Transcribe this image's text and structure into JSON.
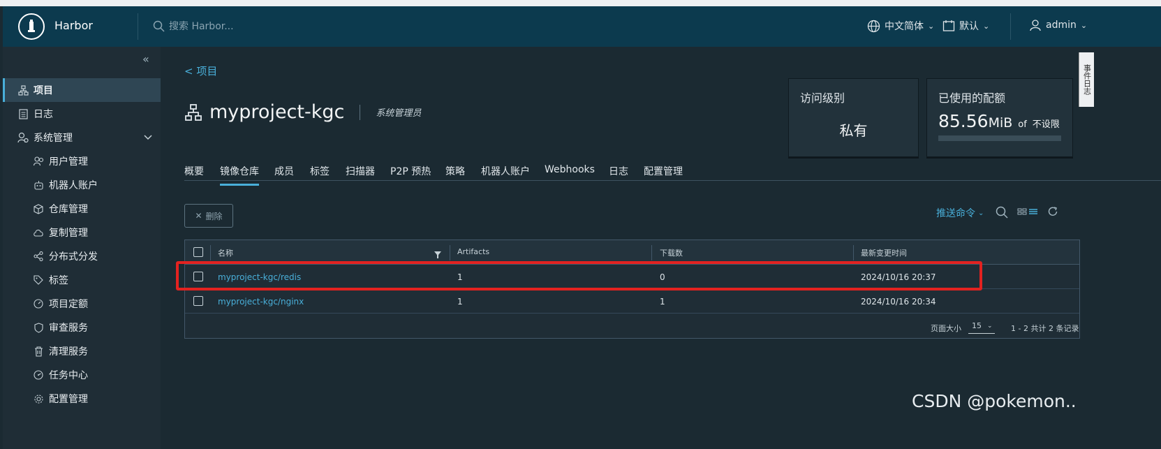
{
  "header": {
    "brand": "Harbor",
    "search_placeholder": "搜索 Harbor...",
    "language": "中文简体",
    "theme": "默认",
    "user": "admin"
  },
  "sidebar": {
    "items": [
      {
        "label": "项目",
        "icon": "project-icon"
      },
      {
        "label": "日志",
        "icon": "log-icon"
      },
      {
        "label": "系统管理",
        "icon": "admin-icon"
      },
      {
        "label": "用户管理",
        "icon": "users-icon"
      },
      {
        "label": "机器人账户",
        "icon": "robot-icon"
      },
      {
        "label": "仓库管理",
        "icon": "cube-icon"
      },
      {
        "label": "复制管理",
        "icon": "cloud-icon"
      },
      {
        "label": "分布式分发",
        "icon": "share-icon"
      },
      {
        "label": "标签",
        "icon": "tag-icon"
      },
      {
        "label": "项目定额",
        "icon": "gauge-icon"
      },
      {
        "label": "审查服务",
        "icon": "shield-icon"
      },
      {
        "label": "清理服务",
        "icon": "trash-icon"
      },
      {
        "label": "任务中心",
        "icon": "dashboard-icon"
      },
      {
        "label": "配置管理",
        "icon": "gear-icon"
      }
    ]
  },
  "main": {
    "back_label": "<  项目",
    "title": "myproject-kgc",
    "role": "系统管理员",
    "access_card": {
      "title": "访问级别",
      "value": "私有"
    },
    "quota_card": {
      "title": "已使用的配额",
      "value": "85.56",
      "unit": "MiB",
      "of": "of",
      "limit": "不设限"
    },
    "tabs": [
      "概要",
      "镜像仓库",
      "成员",
      "标签",
      "扫描器",
      "P2P 预热",
      "策略",
      "机器人账户",
      "Webhooks",
      "日志",
      "配置管理"
    ],
    "active_tab": "镜像仓库",
    "delete_label": "删除",
    "push_command_label": "推送命令",
    "table": {
      "columns": [
        "名称",
        "Artifacts",
        "下载数",
        "最新变更时间"
      ],
      "rows": [
        {
          "name": "myproject-kgc/redis",
          "artifacts": "1",
          "pulls": "0",
          "updated": "2024/10/16 20:37"
        },
        {
          "name": "myproject-kgc/nginx",
          "artifacts": "1",
          "pulls": "1",
          "updated": "2024/10/16 20:34"
        }
      ],
      "page_size_label": "页面大小",
      "page_size": "15",
      "summary": "1 - 2 共计 2 条记录"
    }
  },
  "side_tab": "事件日志",
  "watermark": "CSDN @pokemon..",
  "colors": {
    "accent": "#49afd9",
    "header": "#0c3a4e",
    "highlight": "#e32220"
  }
}
